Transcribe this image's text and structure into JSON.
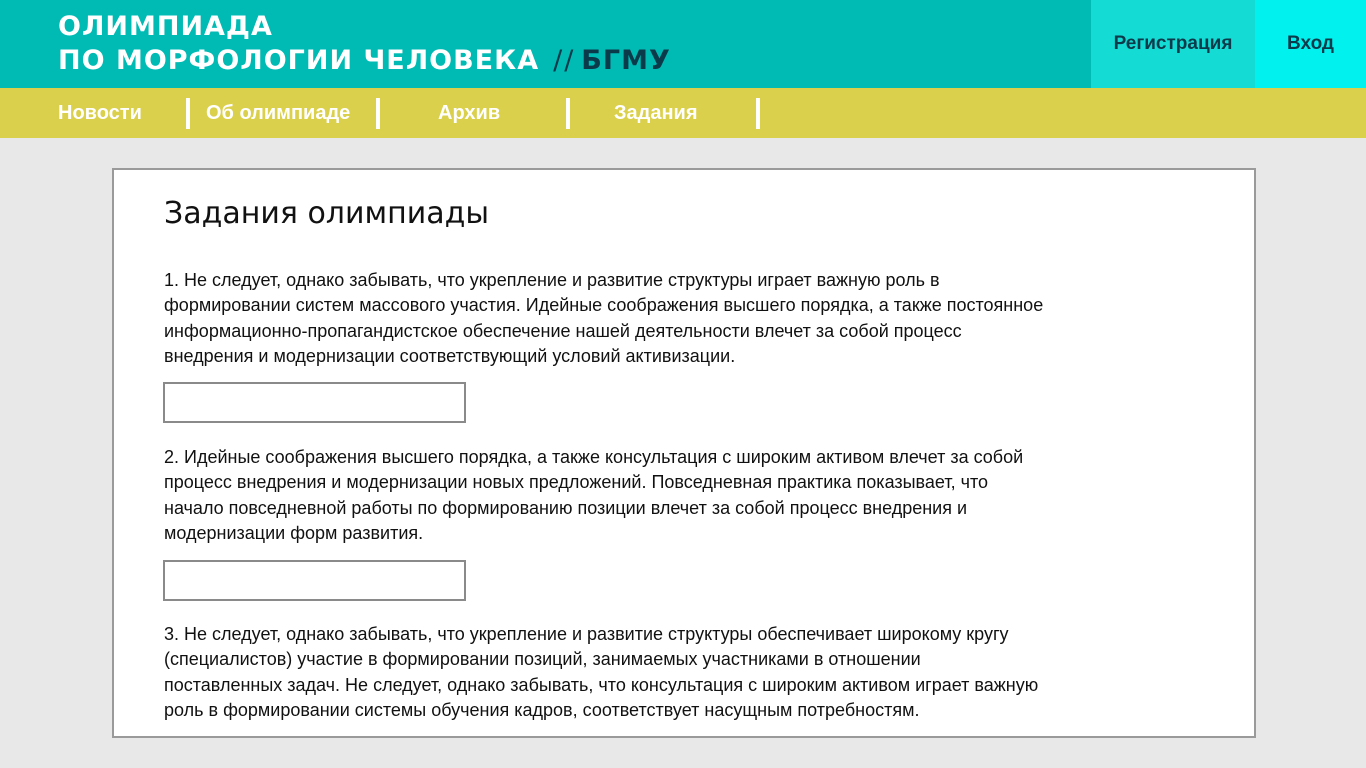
{
  "header": {
    "logo_line1": "Олимпиада",
    "logo_line2": "по морфологии человека",
    "logo_separator": "//",
    "logo_org": "БГМУ",
    "register_label": "Регистрация",
    "login_label": "Вход"
  },
  "nav": {
    "items": [
      {
        "label": "Новости"
      },
      {
        "label": "Об олимпиаде"
      },
      {
        "label": "Архив"
      },
      {
        "label": "Задания"
      }
    ]
  },
  "main": {
    "title": "Задания олимпиады",
    "tasks": [
      {
        "text": "1. Не следует, однако забывать, что укрепление и развитие структуры играет важную роль в формировании систем массового участия. Идейные соображения высшего порядка, а также постоянное информационно-пропагандистское обеспечение нашей деятельности влечет за собой процесс внедрения и модернизации соответствующий условий активизации.",
        "answer_value": "",
        "answer_placeholder": ""
      },
      {
        "text": "2. Идейные соображения высшего порядка, а также консультация с широким активом влечет за собой процесс внедрения и модернизации новых предложений. Повседневная практика показывает, что начало повседневной работы по формированию позиции влечет за собой процесс внедрения и модернизации форм развития.",
        "answer_value": "",
        "answer_placeholder": ""
      },
      {
        "text": "3. Не следует, однако забывать, что укрепление и развитие структуры обеспечивает широкому кругу (специалистов) участие в формировании позиций, занимаемых участниками в отношении поставленных задач. Не следует, однако забывать, что консультация с широким активом играет важную роль в формировании системы обучения кадров, соответствует насущным потребностям."
      }
    ]
  },
  "colors": {
    "header_bg": "#00bab4",
    "register_bg": "#14dbd4",
    "login_bg": "#00f1ee",
    "nav_bg": "#dbd04b",
    "page_bg": "#e8e8e8",
    "accent_text": "#0b3a4a"
  }
}
